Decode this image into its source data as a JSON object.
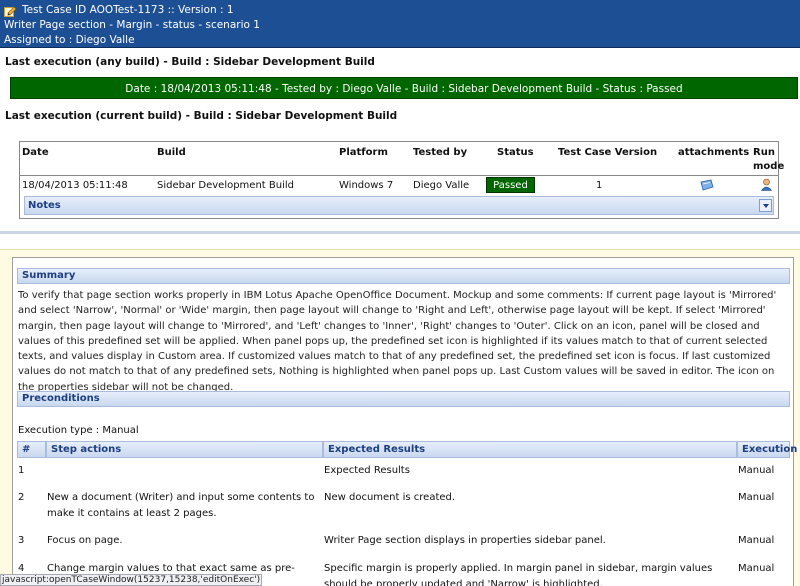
{
  "header": {
    "line1": "Test Case ID AOOTest-1173 :: Version : 1",
    "line2": "Writer Page section - Margin - status - scenario 1",
    "line3": "Assigned to : Diego Valle"
  },
  "last_any": {
    "title": "Last execution (any build) - Build : Sidebar Development Build",
    "bar": "Date : 18/04/2013 05:11:48 - Tested by : Diego Valle - Build : Sidebar Development Build - Status : Passed",
    "bar_color": "#006600"
  },
  "last_current": {
    "title": "Last execution (current build) - Build : Sidebar Development Build"
  },
  "exec_table": {
    "headers": [
      "Date",
      "Build",
      "Platform",
      "Tested by",
      "Status",
      "Test Case Version",
      "attachments",
      "Run",
      "mode"
    ],
    "row": {
      "date": "18/04/2013 05:11:48",
      "build": "Sidebar Development Build",
      "platform": "Windows 7",
      "tested_by": "Diego Valle",
      "status": "Passed",
      "version": "1",
      "attachment_icon": "attachment-icon",
      "run_mode_icon": "person-icon"
    },
    "notes_label": "Notes"
  },
  "summary": {
    "label": "Summary",
    "text": "To verify that page section works properly in IBM Lotus Apache OpenOffice Document. Mockup and some comments: If current page layout is 'Mirrored' and select 'Narrow', 'Normal' or 'Wide' margin, then page layout will change to 'Right and Left', otherwise page layout will be kept. If select 'Mirrored' margin, then page layout will change to 'Mirrored', and 'Left' changes to 'Inner', 'Right' changes to 'Outer'. Click on an icon, panel will be closed and values of this predefined set will be applied. When panel pops up, the predefined set icon is highlighted if its values match to that of current selected texts, and values display in Custom area. If customized values match to that of any predefined set, the predefined set icon is focus. If last customized values do not match to that of any predefined sets, Nothing is highlighted when panel pops up. Last Custom values will be saved in editor. The icon on the properties sidebar will not be changed."
  },
  "preconditions": {
    "label": "Preconditions",
    "execution_type": "Execution type : Manual"
  },
  "steps": {
    "headers": [
      "#",
      "Step actions",
      "Expected Results",
      "Execution"
    ],
    "rows": [
      {
        "n": "1",
        "action": "",
        "expected": "Expected Results",
        "exec": "Manual"
      },
      {
        "n": "2",
        "action": "New a document (Writer) and input some contents to make it contains at least 2 pages.",
        "expected": "New document is created.",
        "exec": "Manual"
      },
      {
        "n": "3",
        "action": "Focus on page.",
        "expected": "Writer Page section displays in properties sidebar panel.",
        "exec": "Manual"
      },
      {
        "n": "4",
        "action": "Change margin values to that exact same as pre-defined margin value set via dialog.",
        "expected": "Specific margin is properly applied. In margin panel in sidebar, margin values should be properly updated and 'Narrow' is highlighted.",
        "exec": "Manual"
      }
    ]
  },
  "statusbar": {
    "text": "javascript:openTCaseWindow(15237,15238,'editOnExec')"
  }
}
